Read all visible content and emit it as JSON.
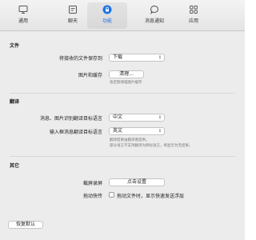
{
  "toolbar": {
    "tabs": [
      {
        "label": "通用",
        "icon": "monitor-icon",
        "active": false
      },
      {
        "label": "聊天",
        "icon": "chat-list-icon",
        "active": false
      },
      {
        "label": "功能",
        "icon": "lock-icon",
        "active": true
      },
      {
        "label": "消息通知",
        "icon": "speech-bubble-icon",
        "active": false
      },
      {
        "label": "应用",
        "icon": "grid-icon",
        "active": false
      }
    ]
  },
  "files": {
    "title": "文件",
    "save_label": "将接收的文件保存到",
    "save_value": "下载",
    "media_label": "图片和缓存",
    "clear_button": "清理...",
    "clear_hint": "会定期清理图片缓存"
  },
  "translate": {
    "title": "翻译",
    "image_label": "消息、图片识别翻译目标语言",
    "image_value": "中文",
    "input_label": "输入框消息翻译目标语言",
    "input_value": "英文",
    "hint_line1": "翻译结果由翻译者提供。",
    "hint_line2": "部分语言不支持翻译为目标语言，将显示为无结果。"
  },
  "other": {
    "title": "其它",
    "screenshot_label": "截屏录屏",
    "screenshot_button": "点击设置",
    "drag_label": "拖动快传",
    "drag_checkbox": "拖动文件时，显示快速发送浮层"
  },
  "footer": {
    "reset_button": "恢复默认"
  },
  "colors": {
    "accent": "#1a73e8",
    "window_bg": "#ececec"
  }
}
